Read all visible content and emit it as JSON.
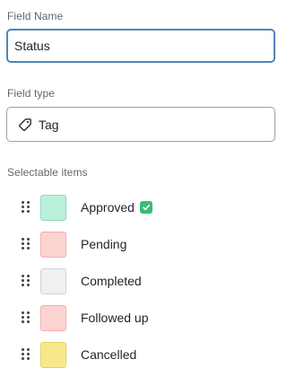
{
  "field_name": {
    "label": "Field Name",
    "value": "Status"
  },
  "field_type": {
    "label": "Field type",
    "value": "Tag",
    "icon": "tag-icon"
  },
  "selectable_items": {
    "label": "Selectable items",
    "items": [
      {
        "label": "Approved",
        "fill": "#b8f0da",
        "border": "#8ed9bc",
        "badge": "check-icon",
        "badge_color": "#3dbb7a"
      },
      {
        "label": "Pending",
        "fill": "#fdd3d1",
        "border": "#f2aeaa"
      },
      {
        "label": "Completed",
        "fill": "#eef0f2",
        "border": "#cfd3d8"
      },
      {
        "label": "Followed up",
        "fill": "#fdd3d1",
        "border": "#f2aeaa"
      },
      {
        "label": "Cancelled",
        "fill": "#f7e98a",
        "border": "#e5d35f"
      }
    ]
  },
  "colors": {
    "focus_border": "#4f86b9",
    "input_border": "#9aa1a9"
  }
}
